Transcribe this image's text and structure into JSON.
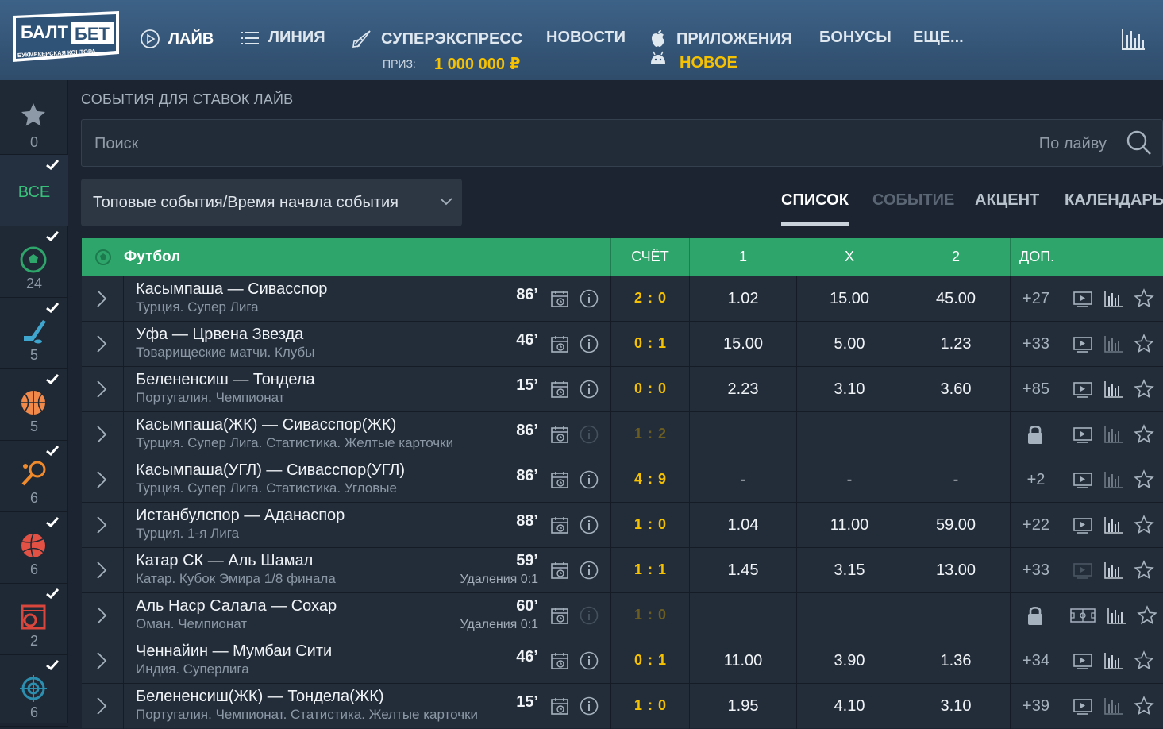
{
  "header": {
    "logo": {
      "line1": "БАЛТ",
      "line2": "БЕТ",
      "tagline": "БУКМЕКЕРСКАЯ КОНТОРА"
    },
    "nav": {
      "live": "ЛАЙВ",
      "line": "ЛИНИЯ",
      "superexpress": "СУПЕРЭКСПРЕСС",
      "prize_label": "ПРИЗ:",
      "prize_value": "1 000 000 ₽",
      "news": "НОВОСТИ",
      "apps": "ПРИЛОЖЕНИЯ",
      "apps_badge": "НОВОЕ",
      "bonuses": "БОНУСЫ",
      "more": "ЕЩЕ..."
    }
  },
  "sidebar": {
    "favorites_count": "0",
    "all_label": "ВСЕ",
    "sports": [
      {
        "icon": "football-icon",
        "count": "24"
      },
      {
        "icon": "hockey-icon",
        "count": "5"
      },
      {
        "icon": "basketball-icon",
        "count": "5"
      },
      {
        "icon": "tennis-icon",
        "count": "6"
      },
      {
        "icon": "volleyball-icon",
        "count": "6"
      },
      {
        "icon": "statistics-football-icon",
        "count": "2"
      },
      {
        "icon": "target-icon",
        "count": "6"
      }
    ]
  },
  "main": {
    "title": "СОБЫТИЯ ДЛЯ СТАВОК ЛАЙВ",
    "search": {
      "placeholder": "Поиск",
      "scope": "По лайву"
    },
    "sort_select": "Топовые события/Время начала события",
    "tabs": [
      "СПИСОК",
      "СОБЫТИЕ",
      "АКЦЕНТ",
      "КАЛЕНДАРЬ"
    ],
    "table": {
      "sport": "Футбол",
      "columns": {
        "score": "СЧЁТ",
        "c1": "1",
        "cx": "X",
        "c2": "2",
        "extra": "ДОП."
      },
      "rows": [
        {
          "name": "Касымпаша — Сивасспор",
          "league": "Турция. Супер Лига",
          "minute": "86’",
          "extra": "",
          "score": "2 : 0",
          "o1": "1.02",
          "ox": "15.00",
          "o2": "45.00",
          "plus": "+27"
        },
        {
          "name": "Уфа — Црвена Звезда",
          "league": "Товарищеские матчи. Клубы",
          "minute": "46’",
          "extra": "",
          "score": "0 : 1",
          "o1": "15.00",
          "ox": "5.00",
          "o2": "1.23",
          "plus": "+33"
        },
        {
          "name": "Белененсиш — Тондела",
          "league": "Португалия. Чемпионат",
          "minute": "15’",
          "extra": "",
          "score": "0 : 0",
          "o1": "2.23",
          "ox": "3.10",
          "o2": "3.60",
          "plus": "+85"
        },
        {
          "name": "Касымпаша(ЖК) — Сивасспор(ЖК)",
          "league": "Турция. Супер Лига. Статистика. Желтые карточки",
          "minute": "86’",
          "extra": "",
          "score": "1 : 2",
          "o1": "",
          "ox": "",
          "o2": "",
          "plus": ""
        },
        {
          "name": "Касымпаша(УГЛ) — Сивасспор(УГЛ)",
          "league": "Турция. Супер Лига. Статистика. Угловые",
          "minute": "86’",
          "extra": "",
          "score": "4 : 9",
          "o1": "-",
          "ox": "-",
          "o2": "-",
          "plus": "+2"
        },
        {
          "name": "Истанбулспор — Аданаспор",
          "league": "Турция. 1-я Лига",
          "minute": "88’",
          "extra": "",
          "score": "1 : 0",
          "o1": "1.04",
          "ox": "11.00",
          "o2": "59.00",
          "plus": "+22"
        },
        {
          "name": "Катар СК — Аль Шамал",
          "league": "Катар. Кубок Эмира 1/8 финала",
          "minute": "59’",
          "extra": "Удаления 0:1",
          "score": "1 : 1",
          "o1": "1.45",
          "ox": "3.15",
          "o2": "13.00",
          "plus": "+33"
        },
        {
          "name": "Аль Наср Салала — Сохар",
          "league": "Оман. Чемпионат",
          "minute": "60’",
          "extra": "Удаления 0:1",
          "score": "1 : 0",
          "o1": "",
          "ox": "",
          "o2": "",
          "plus": ""
        },
        {
          "name": "Ченнайин — Мумбаи Сити",
          "league": "Индия. Суперлига",
          "minute": "46’",
          "extra": "",
          "score": "0 : 1",
          "o1": "11.00",
          "ox": "3.90",
          "o2": "1.36",
          "plus": "+34"
        },
        {
          "name": "Белененсиш(ЖК) — Тондела(ЖК)",
          "league": "Португалия. Чемпионат. Статистика. Желтые карточки",
          "minute": "15’",
          "extra": "",
          "score": "1 : 0",
          "o1": "1.95",
          "ox": "4.10",
          "o2": "3.10",
          "plus": "+39"
        }
      ]
    }
  },
  "colors": {
    "accent_green": "#2ea66b",
    "score_yellow": "#f5c100",
    "header_blue": "#35587b"
  }
}
